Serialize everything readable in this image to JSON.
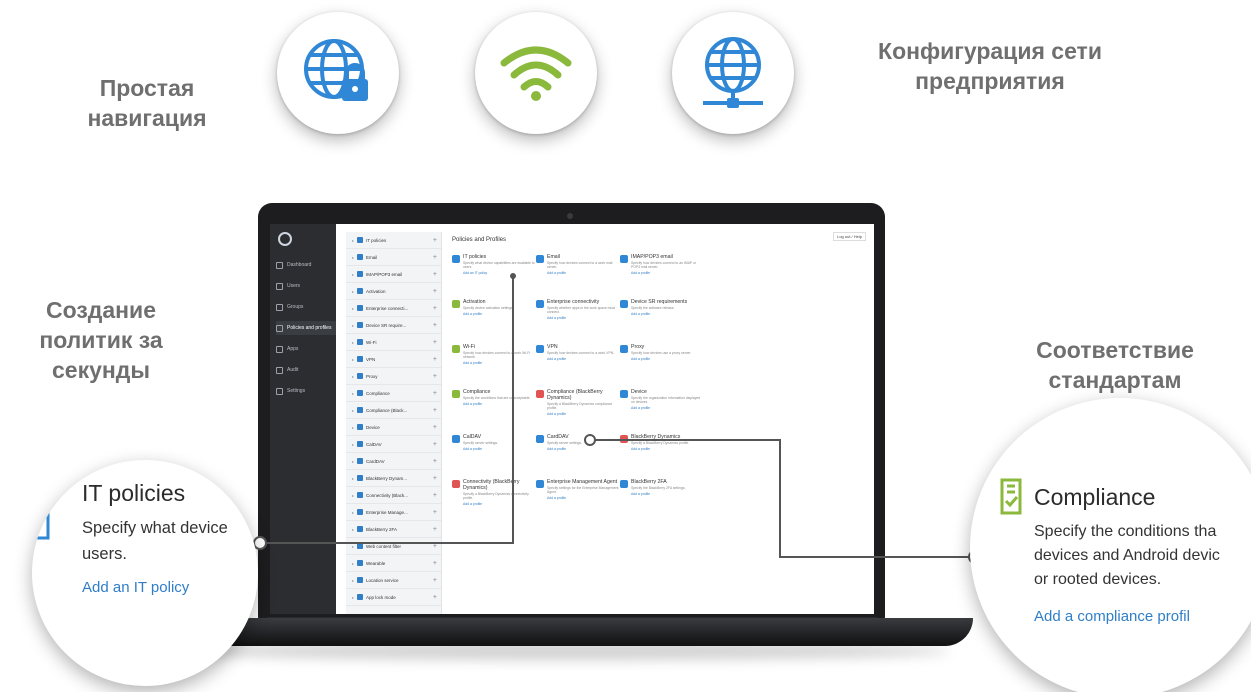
{
  "captions": {
    "navigation": "Простая навигация",
    "network": "Конфигурация сети предприятия",
    "policies": "Создание политик за секунды",
    "standards": "Соответствие стандартам"
  },
  "feature_icons": [
    "globe-lock-icon",
    "wifi-icon",
    "globe-network-icon"
  ],
  "colors": {
    "blue": "#2f87d6",
    "green": "#8ab93b",
    "nav_dark": "#2b2d30",
    "link": "#2f7ec7"
  },
  "app": {
    "nav_items": [
      "Dashboard",
      "Users",
      "Groups",
      "Policies and profiles",
      "Apps",
      "Audit",
      "Settings"
    ],
    "categories": [
      "IT policies",
      "Email",
      "IMAP/POP3 email",
      "Activation",
      "Enterprise connecti...",
      "Device SR require...",
      "Wi-Fi",
      "VPN",
      "Proxy",
      "Compliance",
      "Compliance (Black...",
      "Device",
      "CalDAV",
      "CardDAV",
      "BlackBerry Dynam...",
      "Connectivity (Black...",
      "Enterprise Manage...",
      "BlackBerry 2FA",
      "Web content filter",
      "Wearable",
      "Location service",
      "App lock mode"
    ],
    "title": "Policies and Profiles",
    "user_menu": "Log out / Help",
    "cards": [
      {
        "title": "IT policies",
        "desc": "Specify what device capabilities are available to users.",
        "link": "Add an IT policy",
        "color": "#2f87d6"
      },
      {
        "title": "Email",
        "desc": "Specify how devices connect to a work mail server.",
        "link": "Add a profile",
        "color": "#2f87d6"
      },
      {
        "title": "IMAP/POP3 email",
        "desc": "Specify how devices connect to an IMAP or POP3 mail server.",
        "link": "Add a profile",
        "color": "#2f87d6"
      },
      {
        "title": "Activation",
        "desc": "Specify device activation settings.",
        "link": "Add a profile",
        "color": "#8ab93b"
      },
      {
        "title": "Enterprise connectivity",
        "desc": "Specify whether apps in the work space must connect.",
        "link": "Add a profile",
        "color": "#2f87d6"
      },
      {
        "title": "Device SR requirements",
        "desc": "Specify the software release.",
        "link": "Add a profile",
        "color": "#2f87d6"
      },
      {
        "title": "Wi-Fi",
        "desc": "Specify how devices connect to a work Wi-Fi network.",
        "link": "Add a profile",
        "color": "#8ab93b"
      },
      {
        "title": "VPN",
        "desc": "Specify how devices connect to a work VPN.",
        "link": "Add a profile",
        "color": "#2f87d6"
      },
      {
        "title": "Proxy",
        "desc": "Specify how devices use a proxy server.",
        "link": "Add a profile",
        "color": "#2f87d6"
      },
      {
        "title": "Compliance",
        "desc": "Specify the conditions that are unacceptable.",
        "link": "Add a profile",
        "color": "#8ab93b"
      },
      {
        "title": "Compliance (BlackBerry Dynamics)",
        "desc": "Specify a BlackBerry Dynamics compliance profile.",
        "link": "Add a profile",
        "color": "#e05454"
      },
      {
        "title": "Device",
        "desc": "Specify the organization information displayed on devices.",
        "link": "Add a profile",
        "color": "#2f87d6"
      },
      {
        "title": "CalDAV",
        "desc": "Specify server settings.",
        "link": "Add a profile",
        "color": "#2f87d6"
      },
      {
        "title": "CardDAV",
        "desc": "Specify server settings.",
        "link": "Add a profile",
        "color": "#2f87d6"
      },
      {
        "title": "BlackBerry Dynamics",
        "desc": "Specify a BlackBerry Dynamics profile.",
        "link": "Add a profile",
        "color": "#e05454"
      },
      {
        "title": "Connectivity (BlackBerry Dynamics)",
        "desc": "Specify a BlackBerry Dynamics connectivity profile.",
        "link": "Add a profile",
        "color": "#e05454"
      },
      {
        "title": "Enterprise Management Agent",
        "desc": "Specify settings for the Enterprise Management Agent.",
        "link": "Add a profile",
        "color": "#2f87d6"
      },
      {
        "title": "BlackBerry 2FA",
        "desc": "Specify the BlackBerry 2FA settings.",
        "link": "Add a profile",
        "color": "#2f87d6"
      }
    ]
  },
  "zoom_left": {
    "title": "IT policies",
    "desc_line1": "Specify what device",
    "desc_line2": "users.",
    "link": "Add an IT policy"
  },
  "zoom_right": {
    "title": "Compliance",
    "desc_line1": "Specify the conditions tha",
    "desc_line2": "devices and Android devic",
    "desc_line3": "or rooted devices.",
    "link": "Add a compliance profil"
  }
}
